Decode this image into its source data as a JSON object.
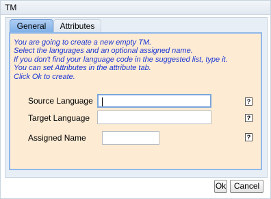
{
  "window": {
    "title": "TM"
  },
  "tabs": [
    {
      "label": "General",
      "active": true
    },
    {
      "label": "Attributes",
      "active": false
    }
  ],
  "intro": {
    "lines": [
      "You are going to create a new empty TM.",
      "Select the languages and an optional assigned name.",
      "If you don't find your language code in the suggested list, type it.",
      "You can set Attributes in the attribute tab.",
      "Click Ok to create."
    ]
  },
  "form": {
    "source_language": {
      "label": "Source Language",
      "value": "",
      "help": "?"
    },
    "target_language": {
      "label": "Target Language",
      "value": "",
      "help": "?"
    },
    "assigned_name": {
      "label": "Assigned Name",
      "value": "",
      "help": "?"
    }
  },
  "buttons": {
    "ok": "Ok",
    "cancel": "Cancel"
  },
  "colors": {
    "intro_text": "#1a35d6",
    "content_background": "#fdebd3",
    "active_tab": "#7fb0e8",
    "focus_border": "#7ba5dc"
  }
}
